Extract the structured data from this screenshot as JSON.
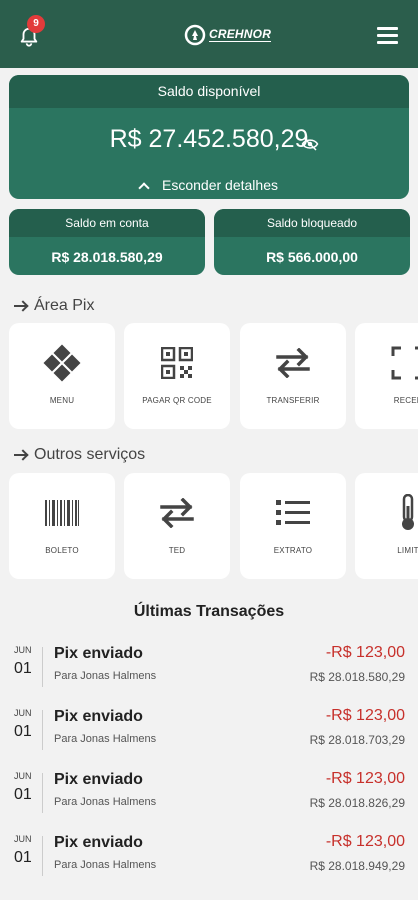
{
  "header": {
    "logo_text": "CREHNOR",
    "notification_count": "9"
  },
  "balance": {
    "title": "Saldo disponível",
    "amount": "R$ 27.452.580,29",
    "hide_label": "Esconder detalhes"
  },
  "account_balance": {
    "title": "Saldo em conta",
    "value": "R$ 28.018.580,29"
  },
  "blocked_balance": {
    "title": "Saldo bloqueado",
    "value": "R$ 566.000,00"
  },
  "pix": {
    "title": "Área Pix",
    "tiles": [
      {
        "label": "MENU",
        "icon": "pix-icon"
      },
      {
        "label": "PAGAR QR CODE",
        "icon": "qr-code-icon"
      },
      {
        "label": "TRANSFERIR",
        "icon": "transfer-icon"
      },
      {
        "label": "RECEB",
        "icon": "scan-icon"
      }
    ]
  },
  "services": {
    "title": "Outros serviços",
    "tiles": [
      {
        "label": "BOLETO",
        "icon": "barcode-icon"
      },
      {
        "label": "TED",
        "icon": "transfer-icon"
      },
      {
        "label": "EXTRATO",
        "icon": "list-icon"
      },
      {
        "label": "LIMIT",
        "icon": "thermometer-icon"
      }
    ]
  },
  "transactions": {
    "title": "Últimas Transações",
    "items": [
      {
        "month": "JUN",
        "day": "01",
        "name": "Pix enviado",
        "desc": "Para Jonas Halmens",
        "amount": "-R$ 123,00",
        "balance": "R$ 28.018.580,29"
      },
      {
        "month": "JUN",
        "day": "01",
        "name": "Pix enviado",
        "desc": "Para Jonas Halmens",
        "amount": "-R$ 123,00",
        "balance": "R$ 28.018.703,29"
      },
      {
        "month": "JUN",
        "day": "01",
        "name": "Pix enviado",
        "desc": "Para Jonas Halmens",
        "amount": "-R$ 123,00",
        "balance": "R$ 28.018.826,29"
      },
      {
        "month": "JUN",
        "day": "01",
        "name": "Pix enviado",
        "desc": "Para Jonas Halmens",
        "amount": "-R$ 123,00",
        "balance": "R$ 28.018.949,29"
      }
    ]
  },
  "colors": {
    "primary": "#2b5e4c",
    "card": "#2b7560",
    "negative": "#c7302b"
  }
}
